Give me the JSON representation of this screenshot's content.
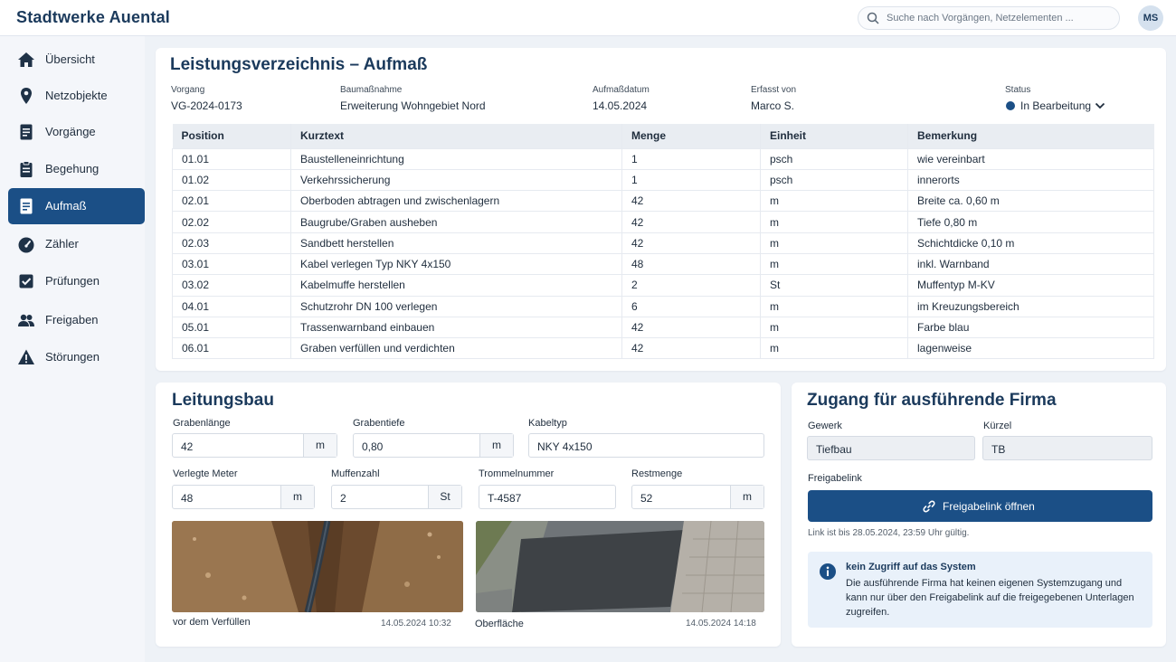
{
  "app": {
    "brand": "Stadtwerke Auental",
    "user_initials": "MS"
  },
  "search": {
    "placeholder": "Suche nach Vorgängen, Netzelementen ..."
  },
  "sidebar": {
    "items": [
      {
        "label": "Übersicht",
        "icon": "home-icon",
        "active": false
      },
      {
        "label": "Netzobjekte",
        "icon": "map-pin-icon",
        "active": false
      },
      {
        "label": "Vorgänge",
        "icon": "document-icon",
        "active": false
      },
      {
        "label": "Begehung",
        "icon": "clipboard-icon",
        "active": false
      },
      {
        "label": "Aufmaß",
        "icon": "document-icon",
        "active": true
      },
      {
        "label": "Zähler",
        "icon": "gauge-icon",
        "active": false
      },
      {
        "label": "Prüfungen",
        "icon": "check-square-icon",
        "active": false
      },
      {
        "label": "Freigaben",
        "icon": "people-icon",
        "active": false
      },
      {
        "label": "Störungen",
        "icon": "warning-icon",
        "active": false
      }
    ]
  },
  "header": {
    "title": "Leistungsverzeichnis – Aufmaß",
    "meta": {
      "vorgang_label": "Vorgang",
      "vorgang": "VG-2024-0173",
      "bau_label": "Baumaßnahme",
      "bau": "Erweiterung Wohngebiet Nord",
      "datum_label": "Aufmaßdatum",
      "datum": "14.05.2024",
      "erfasst_label": "Erfasst von",
      "erfasst": "Marco S.",
      "status_label": "Status",
      "status": "In Bearbeitung"
    }
  },
  "table": {
    "columns": [
      "Position",
      "Kurztext",
      "Menge",
      "Einheit",
      "Bemerkung"
    ],
    "rows": [
      [
        "01.01",
        "Baustelleneinrichtung",
        "1",
        "psch",
        "wie vereinbart"
      ],
      [
        "01.02",
        "Verkehrssicherung",
        "1",
        "psch",
        "innerorts"
      ],
      [
        "02.01",
        "Oberboden abtragen und zwischenlagern",
        "42",
        "m",
        "Breite ca. 0,60 m"
      ],
      [
        "02.02",
        "Baugrube/Graben ausheben",
        "42",
        "m",
        "Tiefe 0,80 m"
      ],
      [
        "02.03",
        "Sandbett herstellen",
        "42",
        "m",
        "Schichtdicke 0,10 m"
      ],
      [
        "03.01",
        "Kabel verlegen Typ NKY 4x150",
        "48",
        "m",
        "inkl. Warnband"
      ],
      [
        "03.02",
        "Kabelmuffe herstellen",
        "2",
        "St",
        "Muffentyp M-KV"
      ],
      [
        "04.01",
        "Schutzrohr DN 100 verlegen",
        "6",
        "m",
        "im Kreuzungsbereich"
      ],
      [
        "05.01",
        "Trassenwarnband einbauen",
        "42",
        "m",
        "Farbe blau"
      ],
      [
        "06.01",
        "Graben verfüllen und verdichten",
        "42",
        "m",
        "lagenweise"
      ]
    ]
  },
  "leitungsbau": {
    "title": "Leitungsbau",
    "grabenlaenge": {
      "label": "Grabenlänge",
      "value": "42",
      "unit": "m"
    },
    "grabentiefe": {
      "label": "Grabentiefe",
      "value": "0,80",
      "unit": "m"
    },
    "kabeltyp": {
      "label": "Kabeltyp",
      "value": "NKY 4x150"
    },
    "verlegte_meter": {
      "label": "Verlegte Meter",
      "value": "48",
      "unit": "m"
    },
    "muffenzahl": {
      "label": "Muffenzahl",
      "value": "2",
      "unit": "St"
    },
    "trommelnummer": {
      "label": "Trommelnummer",
      "value": "T-4587"
    },
    "restmenge": {
      "label": "Restmenge",
      "value": "52",
      "unit": "m"
    },
    "photos": [
      {
        "caption": "vor dem Verfüllen",
        "time": "14.05.2024   10:32"
      },
      {
        "caption": "Oberfläche",
        "time": "14.05.2024   14:18"
      }
    ]
  },
  "zugang": {
    "title": "Zugang für ausführende Firma",
    "gewerk_label": "Gewerk",
    "gewerk": "Tiefbau",
    "kuerzel_label": "Kürzel",
    "kuerzel": "TB",
    "link_label": "Freigabelink",
    "button": "Freigabelink öffnen",
    "validity": "Link ist bis 28.05.2024, 23:59 Uhr gültig.",
    "info_title": "kein Zugriff auf das System",
    "info_text": "Die ausführende Firma hat keinen eigenen Systemzugang und kann nur über den Freigabelink auf die freigegebenen Unterlagen zugreifen."
  },
  "colors": {
    "primary": "#1b4f86",
    "title": "#1b3a5c",
    "background": "#eef2f7"
  }
}
